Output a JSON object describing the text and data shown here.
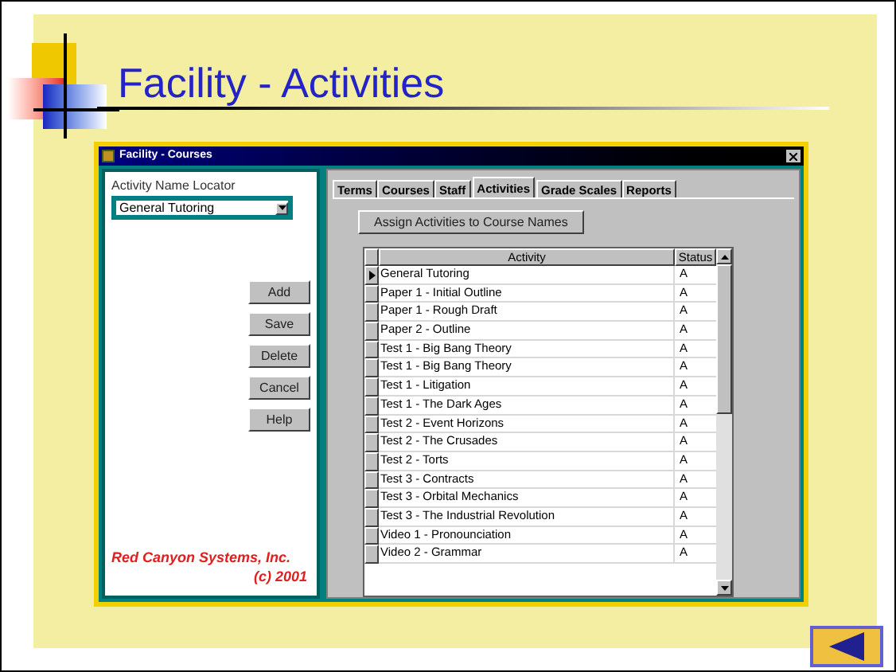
{
  "slide_title": "Facility - Activities",
  "window": {
    "title": "Facility - Courses"
  },
  "locator": {
    "label": "Activity Name Locator",
    "value": "General Tutoring"
  },
  "buttons": [
    "Add",
    "Save",
    "Delete",
    "Cancel",
    "Help"
  ],
  "company": "Red Canyon Systems, Inc.",
  "copyright": "(c) 2001",
  "tabs": [
    {
      "label": "Terms",
      "selected": false
    },
    {
      "label": "Courses",
      "selected": false
    },
    {
      "label": "Staff",
      "selected": false
    },
    {
      "label": "Activities",
      "selected": true
    },
    {
      "label": "Grade Scales",
      "selected": false
    },
    {
      "label": "Reports",
      "selected": false
    }
  ],
  "assign_button": "Assign Activities to Course Names",
  "table": {
    "columns": [
      "Activity",
      "Status"
    ],
    "rows": [
      {
        "activity": "General Tutoring",
        "status": "A",
        "selected": true
      },
      {
        "activity": "Paper 1 - Initial Outline",
        "status": "A",
        "selected": false
      },
      {
        "activity": "Paper 1 - Rough Draft",
        "status": "A",
        "selected": false
      },
      {
        "activity": "Paper 2 - Outline",
        "status": "A",
        "selected": false
      },
      {
        "activity": "Test 1 - Big Bang Theory",
        "status": "A",
        "selected": false
      },
      {
        "activity": "Test 1 - Big Bang Theory",
        "status": "A",
        "selected": false
      },
      {
        "activity": "Test 1 - Litigation",
        "status": "A",
        "selected": false
      },
      {
        "activity": "Test 1 - The Dark Ages",
        "status": "A",
        "selected": false
      },
      {
        "activity": "Test 2 - Event Horizons",
        "status": "A",
        "selected": false
      },
      {
        "activity": "Test 2 - The Crusades",
        "status": "A",
        "selected": false
      },
      {
        "activity": "Test 2 - Torts",
        "status": "A",
        "selected": false
      },
      {
        "activity": "Test 3 - Contracts",
        "status": "A",
        "selected": false
      },
      {
        "activity": "Test 3 - Orbital Mechanics",
        "status": "A",
        "selected": false
      },
      {
        "activity": "Test 3 - The Industrial Revolution",
        "status": "A",
        "selected": false
      },
      {
        "activity": "Video 1 - Pronounciation",
        "status": "A",
        "selected": false
      },
      {
        "activity": "Video 2 - Grammar",
        "status": "A",
        "selected": false
      }
    ]
  }
}
